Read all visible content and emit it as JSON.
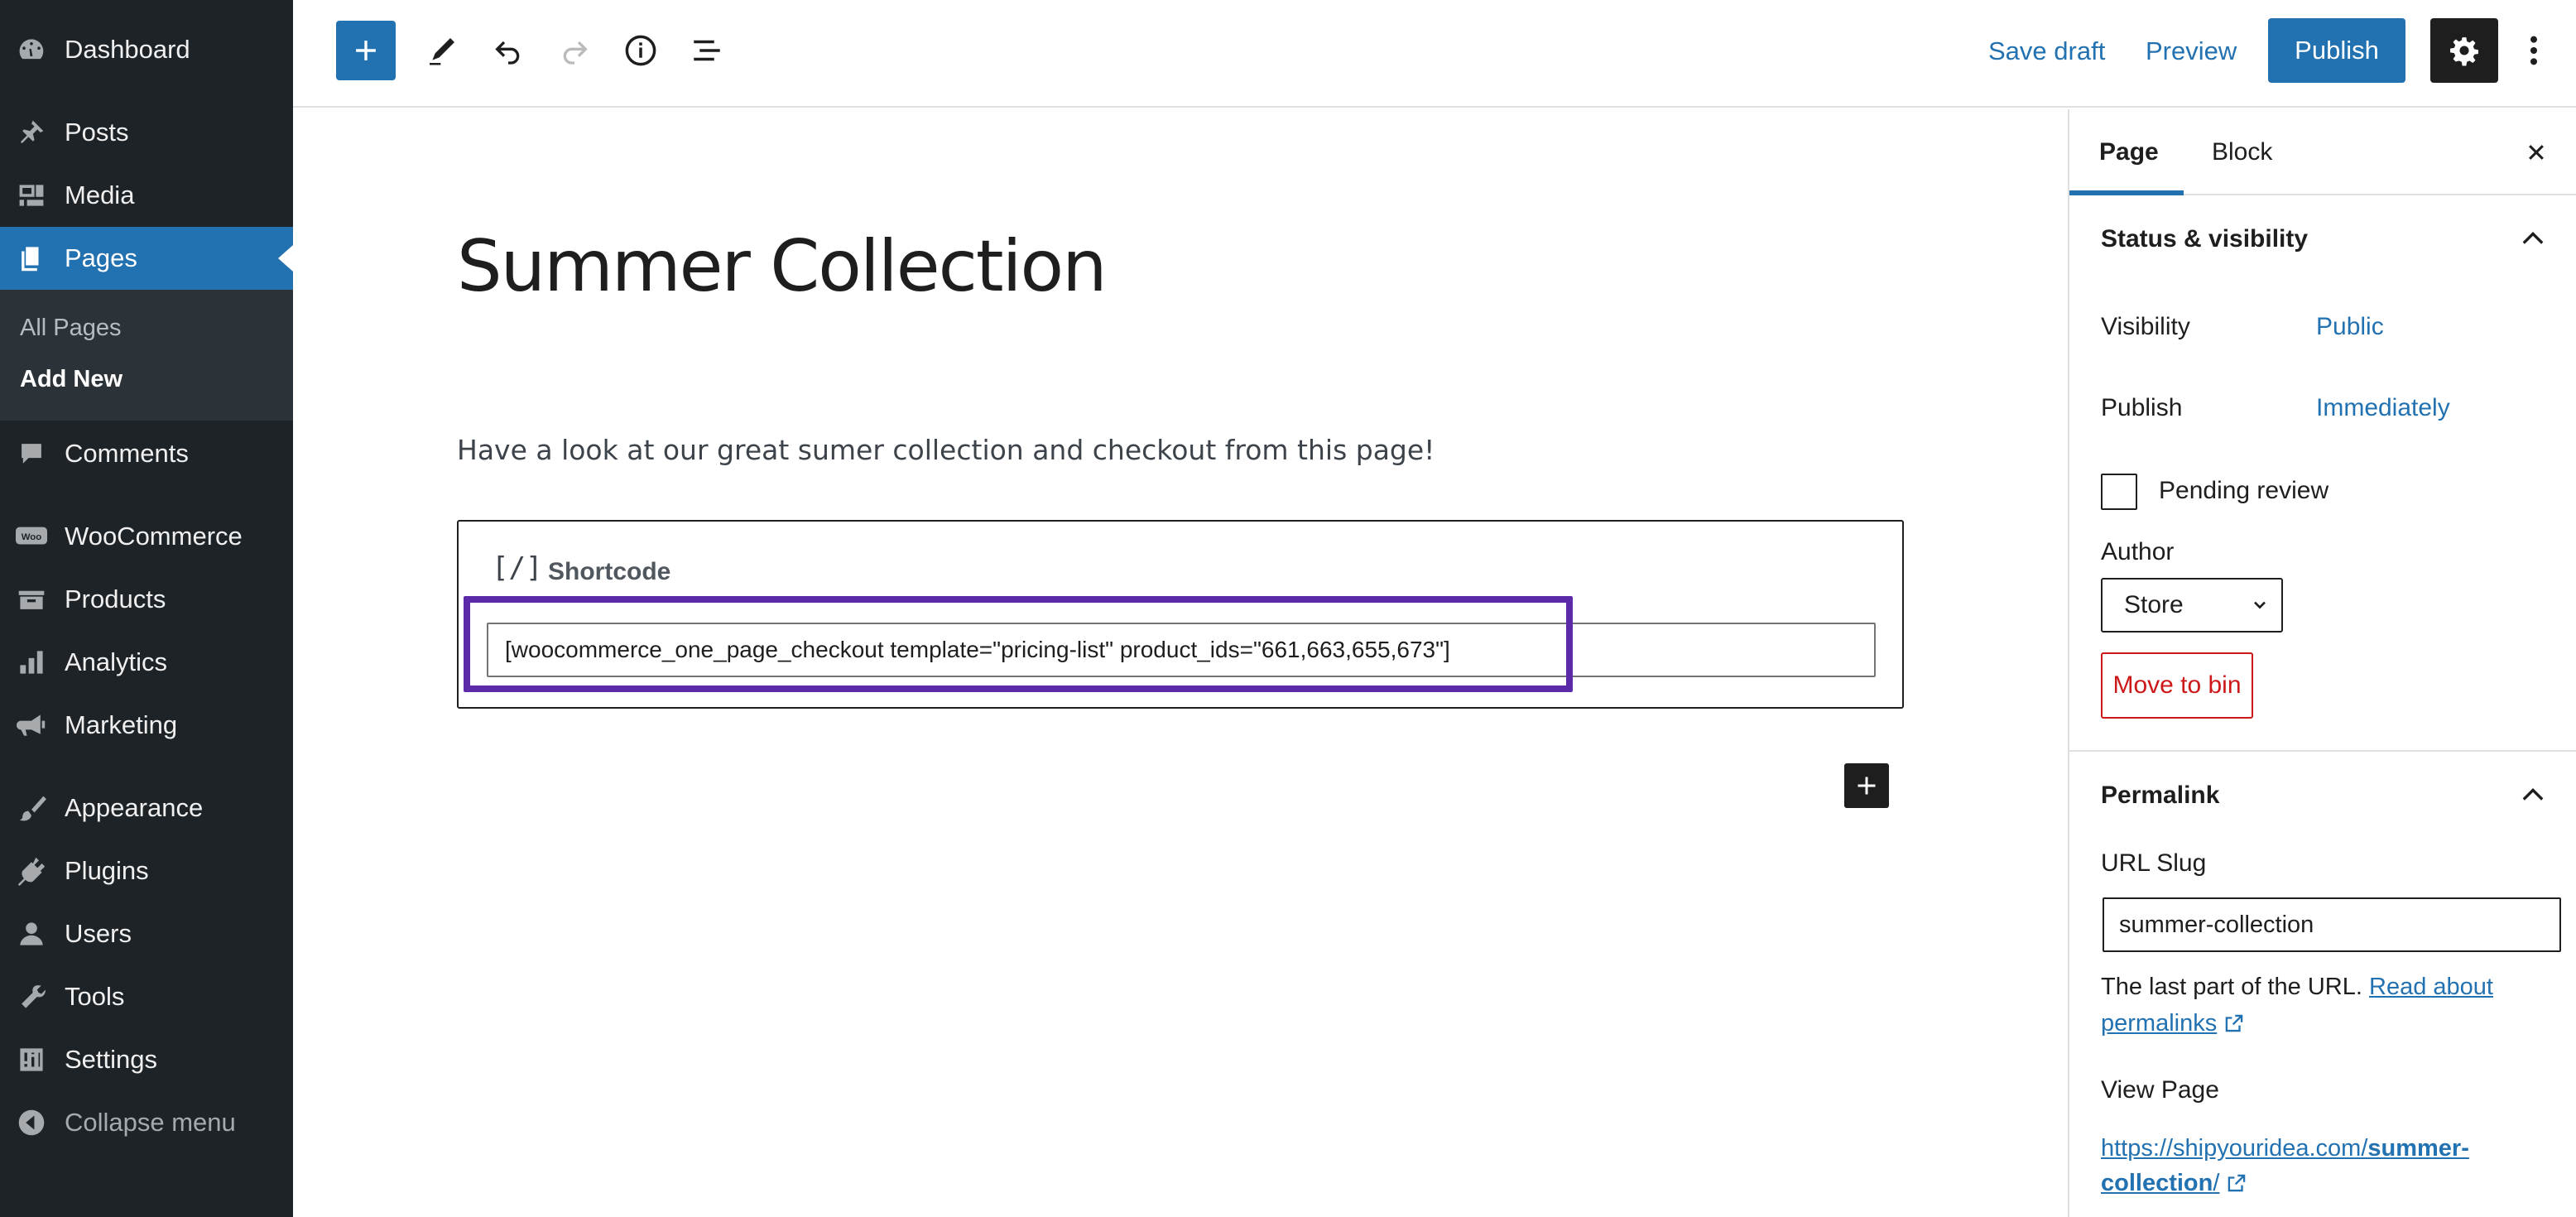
{
  "sidebar": {
    "items": [
      {
        "id": "dashboard",
        "label": "Dashboard",
        "icon": "dashboard-icon"
      },
      {
        "id": "posts",
        "label": "Posts",
        "icon": "pin-icon"
      },
      {
        "id": "media",
        "label": "Media",
        "icon": "media-icon"
      },
      {
        "id": "pages",
        "label": "Pages",
        "icon": "pages-icon"
      },
      {
        "id": "comments",
        "label": "Comments",
        "icon": "comment-icon"
      },
      {
        "id": "woocommerce",
        "label": "WooCommerce",
        "icon": "woo-icon"
      },
      {
        "id": "products",
        "label": "Products",
        "icon": "archive-icon"
      },
      {
        "id": "analytics",
        "label": "Analytics",
        "icon": "bar-chart-icon"
      },
      {
        "id": "marketing",
        "label": "Marketing",
        "icon": "megaphone-icon"
      },
      {
        "id": "appearance",
        "label": "Appearance",
        "icon": "brush-icon"
      },
      {
        "id": "plugins",
        "label": "Plugins",
        "icon": "plug-icon"
      },
      {
        "id": "users",
        "label": "Users",
        "icon": "user-icon"
      },
      {
        "id": "tools",
        "label": "Tools",
        "icon": "wrench-icon"
      },
      {
        "id": "settings",
        "label": "Settings",
        "icon": "sliders-icon"
      }
    ],
    "submenu": {
      "all_pages": "All Pages",
      "add_new": "Add New"
    },
    "collapse": "Collapse menu",
    "woo_badge": "Woo"
  },
  "toolbar": {
    "save_draft": "Save draft",
    "preview": "Preview",
    "publish": "Publish"
  },
  "editor": {
    "title": "Summer Collection",
    "paragraph": "Have a look at our great sumer collection and checkout from this page!",
    "shortcode": {
      "icon_text": "[/]",
      "label": "Shortcode",
      "value": "[woocommerce_one_page_checkout template=\"pricing-list\" product_ids=\"661,663,655,673\"]"
    }
  },
  "settings_panel": {
    "tabs": [
      "Page",
      "Block"
    ],
    "status": {
      "title": "Status & visibility",
      "visibility_label": "Visibility",
      "visibility_value": "Public",
      "publish_label": "Publish",
      "publish_value": "Immediately",
      "pending_review": "Pending review",
      "author_label": "Author",
      "author_value": "Store",
      "move_to_bin": "Move to bin"
    },
    "permalink": {
      "title": "Permalink",
      "url_slug_label": "URL Slug",
      "url_slug_value": "summer-collection",
      "help_text": "The last part of the URL.",
      "help_link": "Read about permalinks",
      "view_page_label": "View Page",
      "url_base": "https://shipyouridea.com/",
      "url_slug_bold": "summer-collection",
      "url_trailing": "/"
    }
  },
  "colors": {
    "admin_bar": "#1d2327",
    "accent": "#2271b1",
    "highlight": "#5b2aa8",
    "danger": "#cc1818"
  }
}
